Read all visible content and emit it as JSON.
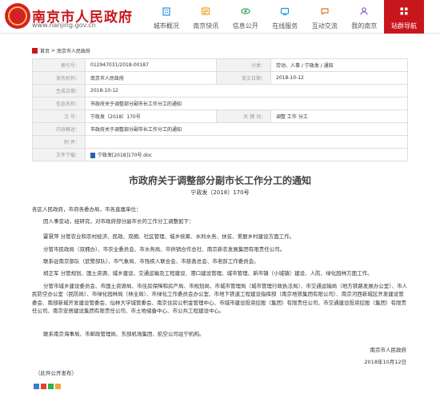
{
  "site": {
    "title": "南京市人民政府",
    "url": "www.nanjing.gov.cn"
  },
  "nav": [
    {
      "label": "城市概况",
      "icon": "building-icon",
      "color": "#2c8ee0"
    },
    {
      "label": "南京快讯",
      "icon": "news-icon",
      "color": "#e8a21b"
    },
    {
      "label": "信息公开",
      "icon": "eye-icon",
      "color": "#3aa655"
    },
    {
      "label": "在线服务",
      "icon": "service-icon",
      "color": "#1a9bd7"
    },
    {
      "label": "互动交流",
      "icon": "chat-icon",
      "color": "#e0742c"
    },
    {
      "label": "我的南京",
      "icon": "user-icon",
      "color": "#8b5ed1"
    },
    {
      "label": "站群导航",
      "icon": "grid-icon",
      "color": "#ffffff",
      "active": true
    }
  ],
  "breadcrumb": {
    "home": "首页",
    "sep": ">",
    "current": "南京市人民政府"
  },
  "meta": {
    "index_label": "索引号：",
    "index_value": "012947031/2018-00187",
    "category_label": "分类：",
    "category_value": "劳动、人事 / 宁政发 / 通知",
    "publisher_label": "发布机构：",
    "publisher_value": "南京市人民政府",
    "pubdate_label": "发文日期：",
    "pubdate_value": "2018-10-12",
    "gen_label": "生成日期：",
    "gen_value": "2018-10-12",
    "title_label": "信息名称：",
    "title_value": "市政府关于调整部分副市长工作分工的通知",
    "docno_label": "文  号：",
    "docno_value": "宁政发〔2018〕170号",
    "keyword_label": "关 键 词：",
    "keyword_value": "调整 工作 分工",
    "summary_label": "内容概述：",
    "summary_value": "市政府关于调整部分副市长工作分工的通知",
    "attach_label": "附    件：",
    "attach_value": "",
    "download_label": "文件下载：",
    "download_value": "宁政发[2018]170号.doc"
  },
  "notice": {
    "title": "市政府关于调整部分副市长工作分工的通知",
    "doc_num": "宁政发〔2018〕170号",
    "addressee": "各区人民政府，市府各委办局，市各直属单位：",
    "intro": "因人事变动，经研究，对市政府部分副市长的工作分工调整如下：",
    "p1": "霍慧萍  分管农业和农村经济、民政、双拥、社区管理、城乡统筹、水利水务、扶贫、美丽乡村建设方面工作。",
    "p2": "分管市民政局（双拥办）、市农业委员会、市水务局、市供销合作总社、南京新农发展集团有限责任公司。",
    "p3": "联系驻南京部队（武警部队）、市气象局、市残疾人联合会、市慈善总会、市老龄工作委员会。",
    "p4": "胡正军  分管规划、国土资源、城乡建设、交通运输及工程建设、港口建设管理、城市管理、新市镇（小城镇）建设、人防、绿化园林方面工作。",
    "p5": "分管市城乡建设委员会、市国土资源局、市住房保障和房产局、市规划局、市城市管理局（城市管理行政执法局）、市交通运输局（地方铁路发展办公室）、市人民防空办公室（民防局）、市绿化园林局（林业局）、市绿化工作委员会办公室、市地下铁道工程建设指挥部（南京地铁集团有限公司）、南京河西新城区开发建设管委会、南部新城开发建设管委会、仙林大学城管委会、南京住房公积金管理中心、市城市建设投资控股（集团）有限责任公司、市交通建设投资控股（集团）有限责任公司、南京安居建设集团有限责任公司、市土地储备中心、市公共工程建设中心。",
    "p6": "联系南京海事局、市邮政管理局、东部机场集团、航空公司驻宁机构。",
    "signer": "南京市人民政府",
    "sign_date": "2018年10月12日",
    "disclosure": "（此件公开发布）"
  },
  "colors": {
    "brand_red": "#c8161d"
  }
}
